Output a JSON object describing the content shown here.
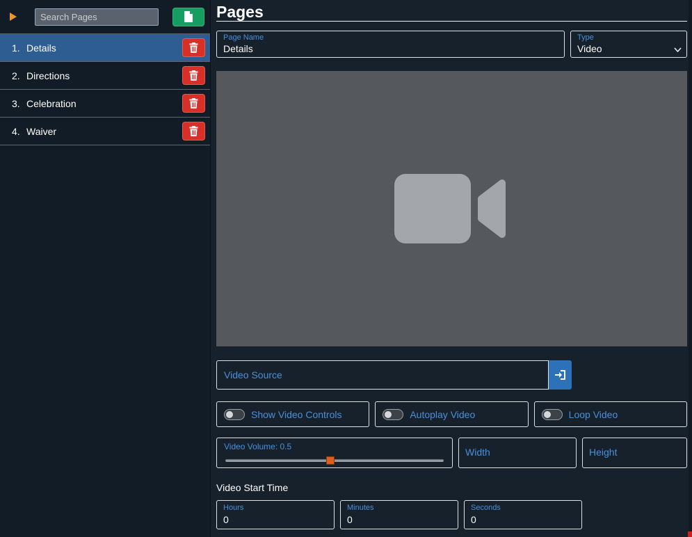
{
  "sidebar": {
    "search": {
      "placeholder": "Search Pages"
    },
    "add_page_icon": "add-page-icon",
    "expander_icon": "orange-arrow-icon",
    "items": [
      {
        "number": "1.",
        "name": "Details",
        "selected": true
      },
      {
        "number": "2.",
        "name": "Directions",
        "selected": false
      },
      {
        "number": "3.",
        "name": "Celebration",
        "selected": false
      },
      {
        "number": "4.",
        "name": "Waiver",
        "selected": false
      }
    ]
  },
  "main": {
    "title": "Pages",
    "page_name": {
      "label": "Page Name",
      "value": "Details"
    },
    "type": {
      "label": "Type",
      "value": "Video"
    },
    "video_preview": {
      "icon": "video-camera-icon"
    },
    "video_source": {
      "placeholder": "Video Source",
      "button_icon": "import-icon"
    },
    "toggles": [
      {
        "label": "Show Video Controls",
        "on": false
      },
      {
        "label": "Autoplay Video",
        "on": false
      },
      {
        "label": "Loop Video",
        "on": false
      }
    ],
    "volume": {
      "label": "Video Volume: 0.5",
      "value": 0.5
    },
    "width": {
      "label": "Width",
      "value": ""
    },
    "height": {
      "label": "Height",
      "value": ""
    },
    "start_time": {
      "label": "Video Start Time",
      "fields": [
        {
          "label": "Hours",
          "value": "0"
        },
        {
          "label": "Minutes",
          "value": "0"
        },
        {
          "label": "Seconds",
          "value": "0"
        }
      ]
    }
  },
  "colors": {
    "accent_blue": "#4a90d9",
    "selected_item_blue": "#2e5e91",
    "delete_red": "#d63029",
    "add_green": "#169e62",
    "expander_orange": "#e89430",
    "import_button_blue": "#2d72b8",
    "slider_thumb_orange": "#dd5f1d",
    "preview_gray": "#55585d"
  }
}
